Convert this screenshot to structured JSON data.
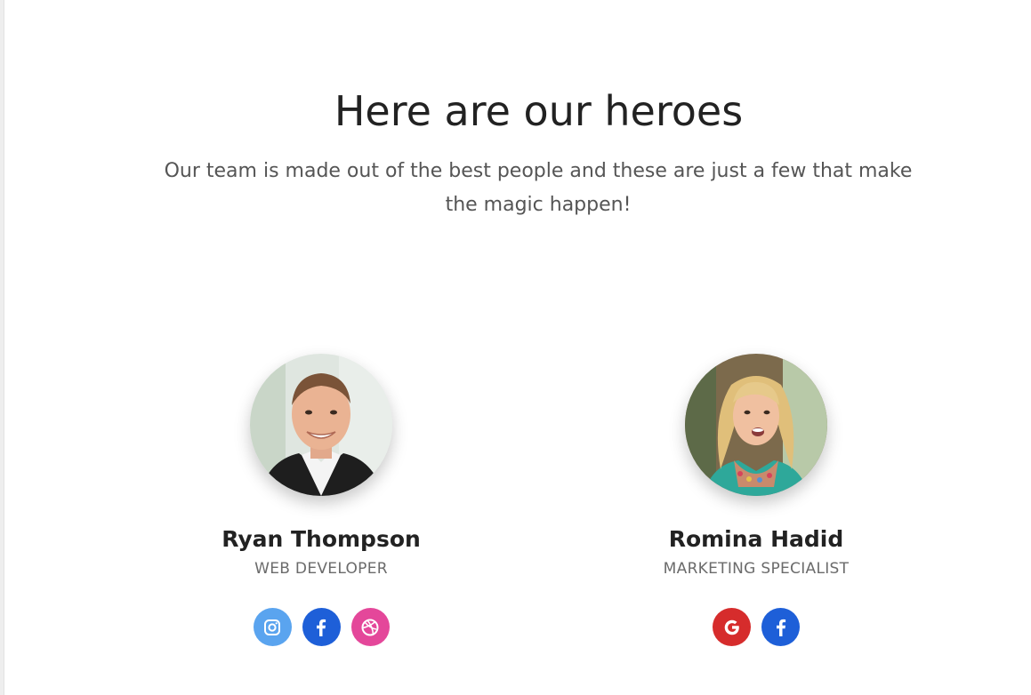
{
  "section": {
    "title": "Here are our heroes",
    "subtitle": "Our team is made out of the best people and these are just a few that make the magic happen!"
  },
  "team": [
    {
      "name": "Ryan Thompson",
      "role": "WEB DEVELOPER",
      "socials": [
        {
          "icon": "instagram-icon",
          "color": "#5aa4ef"
        },
        {
          "icon": "facebook-icon",
          "color": "#1e5fd8"
        },
        {
          "icon": "dribbble-icon",
          "color": "#e4479a"
        }
      ]
    },
    {
      "name": "Romina Hadid",
      "role": "MARKETING SPECIALIST",
      "socials": [
        {
          "icon": "google-icon",
          "color": "#d62c2c"
        },
        {
          "icon": "facebook-icon",
          "color": "#1e5fd8"
        }
      ]
    }
  ]
}
